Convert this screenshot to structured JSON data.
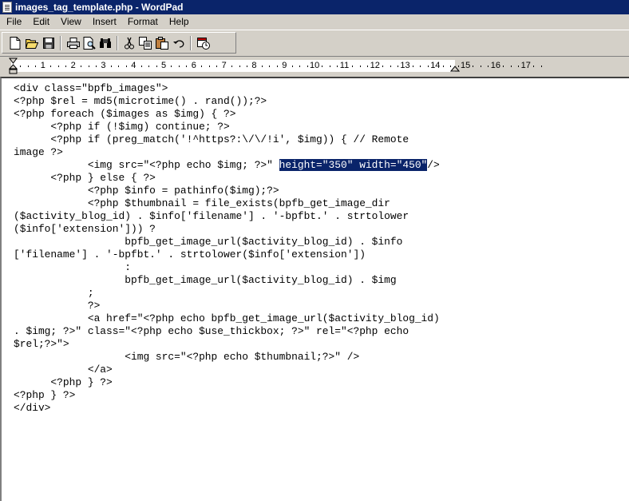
{
  "window": {
    "title": "images_tag_template.php - WordPad"
  },
  "menu": [
    "File",
    "Edit",
    "View",
    "Insert",
    "Format",
    "Help"
  ],
  "toolbar": {
    "buttons": [
      {
        "name": "new-document-icon"
      },
      {
        "name": "open-icon"
      },
      {
        "name": "save-icon"
      },
      {
        "name": "print-icon"
      },
      {
        "name": "print-preview-icon"
      },
      {
        "name": "find-icon"
      },
      {
        "name": "cut-icon"
      },
      {
        "name": "copy-icon"
      },
      {
        "name": "paste-icon"
      },
      {
        "name": "undo-icon"
      },
      {
        "name": "date-time-icon"
      }
    ]
  },
  "ruler": {
    "labels": [
      "1",
      "2",
      "3",
      "4",
      "5",
      "6",
      "7",
      "8",
      "9",
      "10",
      "11",
      "12",
      "13",
      "14",
      "15",
      "16",
      "17"
    ]
  },
  "document": {
    "lines": [
      {
        "text": "<div class=\"bpfb_images\">"
      },
      {
        "text": "<?php $rel = md5(microtime() . rand());?>"
      },
      {
        "text": "<?php foreach ($images as $img) { ?>"
      },
      {
        "text": "\t<?php if (!$img) continue; ?>"
      },
      {
        "text": "\t<?php if (preg_match('!^https?:\\/\\/!i', $img)) { // Remote"
      },
      {
        "text": "image ?>"
      },
      {
        "text": "\t\t<img src=\"<?php echo $img; ?>\" ",
        "selected": "height=\"350\" width=\"450\"",
        "after": "/>"
      },
      {
        "text": "\t<?php } else { ?>"
      },
      {
        "text": "\t\t<?php $info = pathinfo($img);?>"
      },
      {
        "text": "\t\t<?php $thumbnail = file_exists(bpfb_get_image_dir"
      },
      {
        "text": "($activity_blog_id) . $info['filename'] . '-bpfbt.' . strtolower"
      },
      {
        "text": "($info['extension'])) ?"
      },
      {
        "text": "\t\t\tbpfb_get_image_url($activity_blog_id) . $info"
      },
      {
        "text": "['filename'] . '-bpfbt.' . strtolower($info['extension'])"
      },
      {
        "text": "\t\t\t:"
      },
      {
        "text": "\t\t\tbpfb_get_image_url($activity_blog_id) . $img"
      },
      {
        "text": "\t\t;"
      },
      {
        "text": "\t\t?>"
      },
      {
        "text": "\t\t<a href=\"<?php echo bpfb_get_image_url($activity_blog_id)"
      },
      {
        "text": ". $img; ?>\" class=\"<?php echo $use_thickbox; ?>\" rel=\"<?php echo"
      },
      {
        "text": "$rel;?>\">"
      },
      {
        "text": "\t\t\t<img src=\"<?php echo $thumbnail;?>\" />"
      },
      {
        "text": "\t\t</a>"
      },
      {
        "text": "\t<?php } ?>"
      },
      {
        "text": "<?php } ?>"
      },
      {
        "text": "</div>"
      }
    ]
  },
  "colors": {
    "titlebar": "#0a246a",
    "chrome": "#d4d0c8",
    "selection": "#0a246a"
  }
}
